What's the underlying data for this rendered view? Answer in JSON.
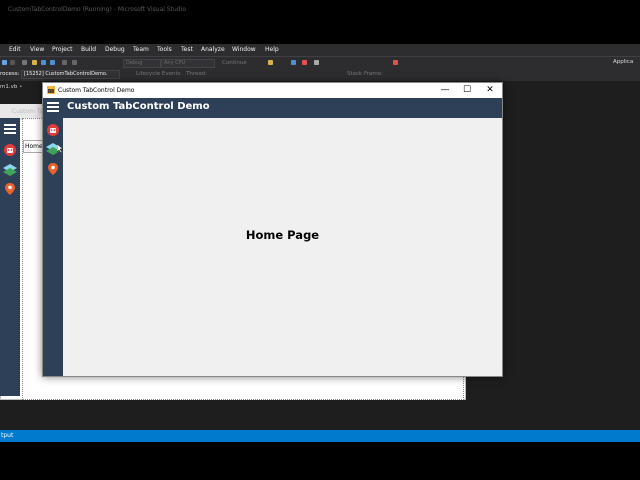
{
  "vs": {
    "title": "CustomTabControlDemo (Running) - Microsoft Visual Studio",
    "menu": [
      "Edit",
      "View",
      "Project",
      "Build",
      "Debug",
      "Team",
      "Tools",
      "Test",
      "Analyze",
      "Window",
      "Help"
    ],
    "toolbar": {
      "config": "Debug",
      "platform": "Any CPU",
      "continue_label": "Continue",
      "applica_label": "Applica"
    },
    "process_bar": {
      "label": "rocess:",
      "process": "[15252] CustomTabControlDemo.",
      "lifecycle": "Lifecycle Events",
      "thread": "Thread:",
      "stack": "Stack Frame:"
    },
    "doc_tab": "m1.vb",
    "status": "tput"
  },
  "designer": {
    "title": "Custom Ta",
    "tab_label": "Home"
  },
  "app": {
    "window_title": "Custom TabControl Demo",
    "header_title": "Custom TabControl Demo",
    "page_heading": "Home Page",
    "controls": {
      "minimize": "—",
      "maximize": "☐",
      "close": "✕"
    }
  },
  "colors": {
    "nav_background": "#2e4057",
    "vs_status": "#007acc",
    "vs_chrome": "#2d2d30"
  },
  "icons": [
    "hamburger-menu-icon",
    "robot-icon",
    "layers-icon",
    "location-pin-icon"
  ]
}
